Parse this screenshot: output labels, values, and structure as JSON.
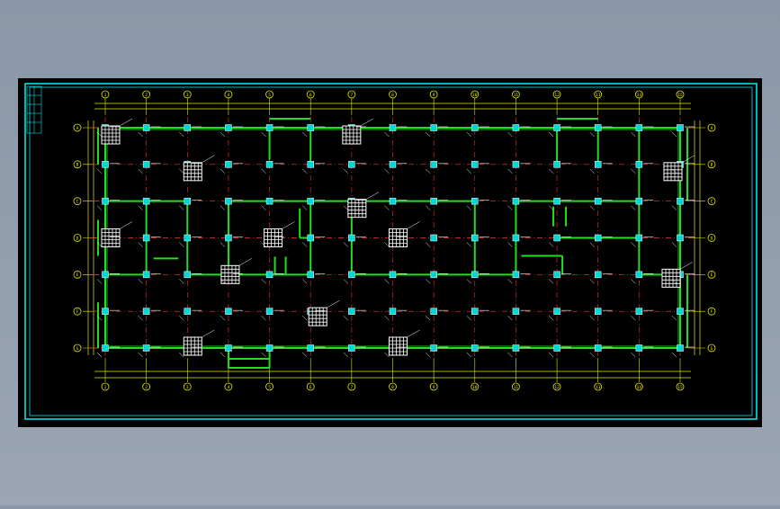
{
  "drawing": {
    "title": "",
    "scale_note": "",
    "sheet_no": "",
    "corner_note": ""
  },
  "grid": {
    "columns": [
      "1",
      "2",
      "3",
      "4",
      "5",
      "6",
      "7",
      "8",
      "9",
      "10",
      "11",
      "12",
      "13",
      "14",
      "15"
    ],
    "rows": [
      "A",
      "B",
      "C",
      "D",
      "E",
      "F",
      "G"
    ]
  },
  "colors": {
    "background": "#000000",
    "frame": "#00e5e5",
    "wall": "#22dd22",
    "axis": "#ff3030",
    "dimension": "#e8e800",
    "column": "#00d8d8",
    "text": "#ffffff"
  }
}
